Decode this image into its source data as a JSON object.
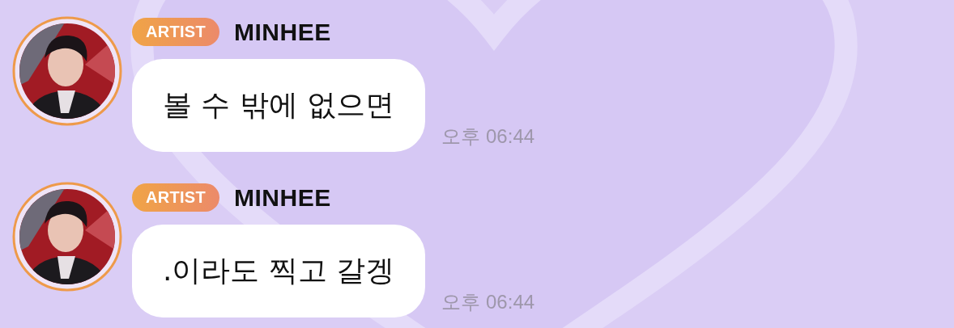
{
  "messages": [
    {
      "badge": "ARTIST",
      "sender": "MINHEE",
      "text": "볼 수 밖에 없으면",
      "time": "오후 06:44"
    },
    {
      "badge": "ARTIST",
      "sender": "MINHEE",
      "text": ".이라도 찍고 갈겡",
      "time": "오후 06:44"
    }
  ]
}
